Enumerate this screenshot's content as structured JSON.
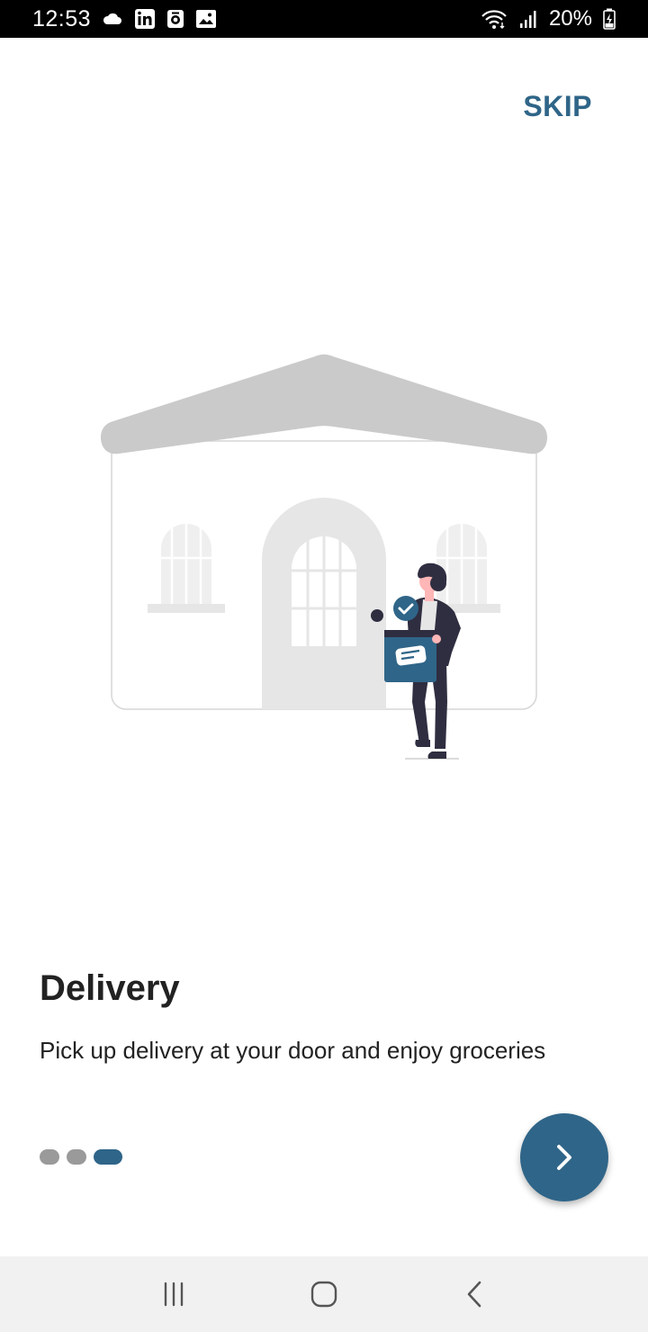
{
  "status_bar": {
    "time": "12:53",
    "battery_percent": "20%",
    "left_icons": [
      "cloud-icon",
      "linkedin-icon",
      "camera-app-icon",
      "gallery-icon"
    ],
    "right_icons": [
      "wifi-icon",
      "signal-icon",
      "battery-charging-icon"
    ]
  },
  "header": {
    "skip_label": "SKIP"
  },
  "onboarding": {
    "title": "Delivery",
    "description": "Pick up delivery at your door and enjoy groceries",
    "page_count": 3,
    "current_page": 3,
    "illustration": "delivery-person-at-house-illustration"
  },
  "next_button": {
    "icon": "chevron-right-icon"
  },
  "nav_bar": {
    "items": [
      "recent-apps-icon",
      "home-icon",
      "back-icon"
    ]
  },
  "colors": {
    "accent": "#2f6588",
    "dot_inactive": "#9a9a9a",
    "text": "#222222",
    "status_bar": "#000000",
    "nav_bar": "#f1f1f1"
  }
}
